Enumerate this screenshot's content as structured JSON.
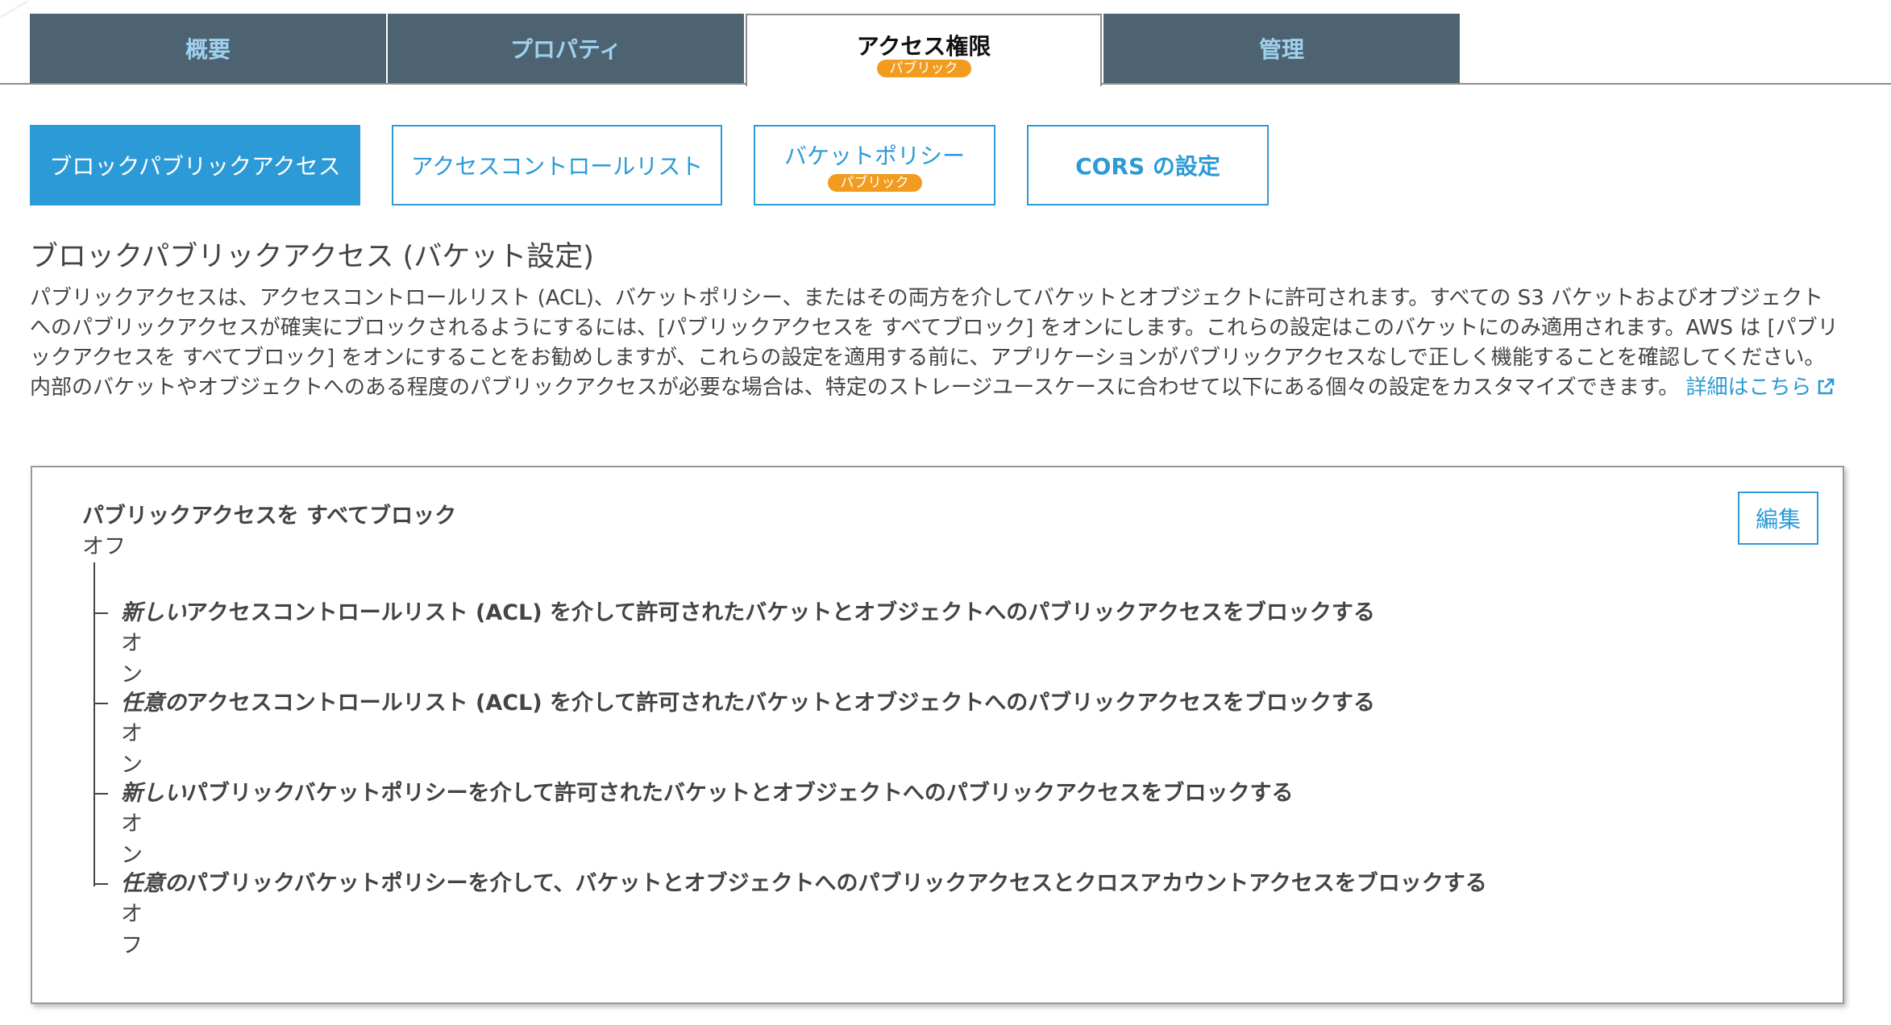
{
  "tabs": [
    {
      "label": "概要",
      "badge": "",
      "active": false
    },
    {
      "label": "プロパティ",
      "badge": "",
      "active": false
    },
    {
      "label": "アクセス権限",
      "badge": "パブリック",
      "active": true
    },
    {
      "label": "管理",
      "badge": "",
      "active": false
    }
  ],
  "subnav": [
    {
      "label": "ブロックパブリックアクセス",
      "badge": "",
      "active": true
    },
    {
      "label": "アクセスコントロールリスト",
      "badge": "",
      "active": false
    },
    {
      "label": "バケットポリシー",
      "badge": "パブリック",
      "active": false
    },
    {
      "label": "CORS の設定",
      "badge": "",
      "active": false
    }
  ],
  "section": {
    "title": "ブロックパブリックアクセス (バケット設定)",
    "description": "パブリックアクセスは、アクセスコントロールリスト (ACL)、バケットポリシー、またはその両方を介してバケットとオブジェクトに許可されます。すべての S3 バケットおよびオブジェクトへのパブリックアクセスが確実にブロックされるようにするには、[パブリックアクセスを すべてブロック] をオンにします。これらの設定はこのバケットにのみ適用されます。AWS は [パブリックアクセスを すべてブロック] をオンにすることをお勧めしますが、これらの設定を適用する前に、アプリケーションがパブリックアクセスなしで正しく機能することを確認してください。内部のバケットやオブジェクトへのある程度のパブリックアクセスが必要な場合は、特定のストレージユースケースに合わせて以下にある個々の設定をカスタマイズできます。",
    "learn_more": "詳細はこちら"
  },
  "panel": {
    "edit_label": "編集",
    "master": {
      "title": "パブリックアクセスを すべてブロック",
      "value": "オフ"
    },
    "settings": [
      {
        "emphasis": "新しい",
        "rest": "アクセスコントロールリスト (ACL) を介して許可されたバケットとオブジェクトへのパブリックアクセスをブロックする",
        "value": "オン"
      },
      {
        "emphasis": "任意の",
        "rest": "アクセスコントロールリスト (ACL) を介して許可されたバケットとオブジェクトへのパブリックアクセスをブロックする",
        "value": "オン"
      },
      {
        "emphasis": "新しい",
        "rest": "パブリックバケットポリシーを介して許可されたバケットとオブジェクトへのパブリックアクセスをブロックする",
        "value": "オン"
      },
      {
        "emphasis": "任意の",
        "rest": "パブリックバケットポリシーを介して、バケットとオブジェクトへのパブリックアクセスとクロスアカウントアクセスをブロックする",
        "value": "オフ"
      }
    ]
  },
  "colors": {
    "tab_bg": "#4d6372",
    "tab_text": "#9fd1ee",
    "accent": "#2c9ad6",
    "badge": "#f29c1f",
    "text": "#444444"
  },
  "icons": {
    "external_link": "external-link-icon"
  }
}
